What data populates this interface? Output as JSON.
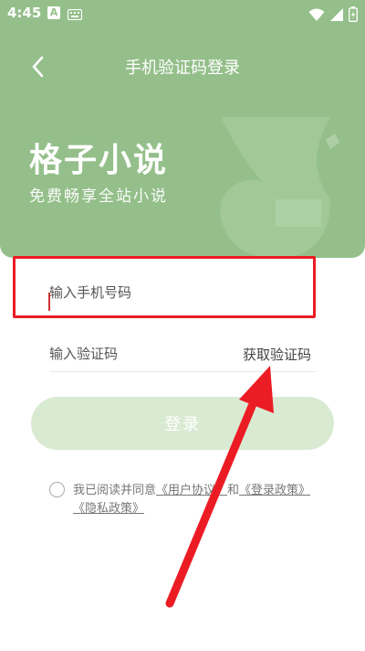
{
  "status_bar": {
    "time": "4:45",
    "app_badge": "A"
  },
  "nav": {
    "title": "手机验证码登录"
  },
  "brand": {
    "title": "格子小说",
    "subtitle": "免费畅享全站小说"
  },
  "form": {
    "phone_placeholder": "输入手机号码",
    "code_placeholder": "输入验证码",
    "get_code_label": "获取验证码",
    "login_label": "登录"
  },
  "agreement": {
    "prefix": "我已阅读并同意",
    "user_agreement": "《用户协议》",
    "and": "和",
    "login_policy": "《登录政策》",
    "privacy_policy": "《隐私政策》"
  },
  "colors": {
    "header_green": "#94bf8a",
    "login_button": "#d9ead3",
    "highlight_red": "#ec1c24"
  }
}
